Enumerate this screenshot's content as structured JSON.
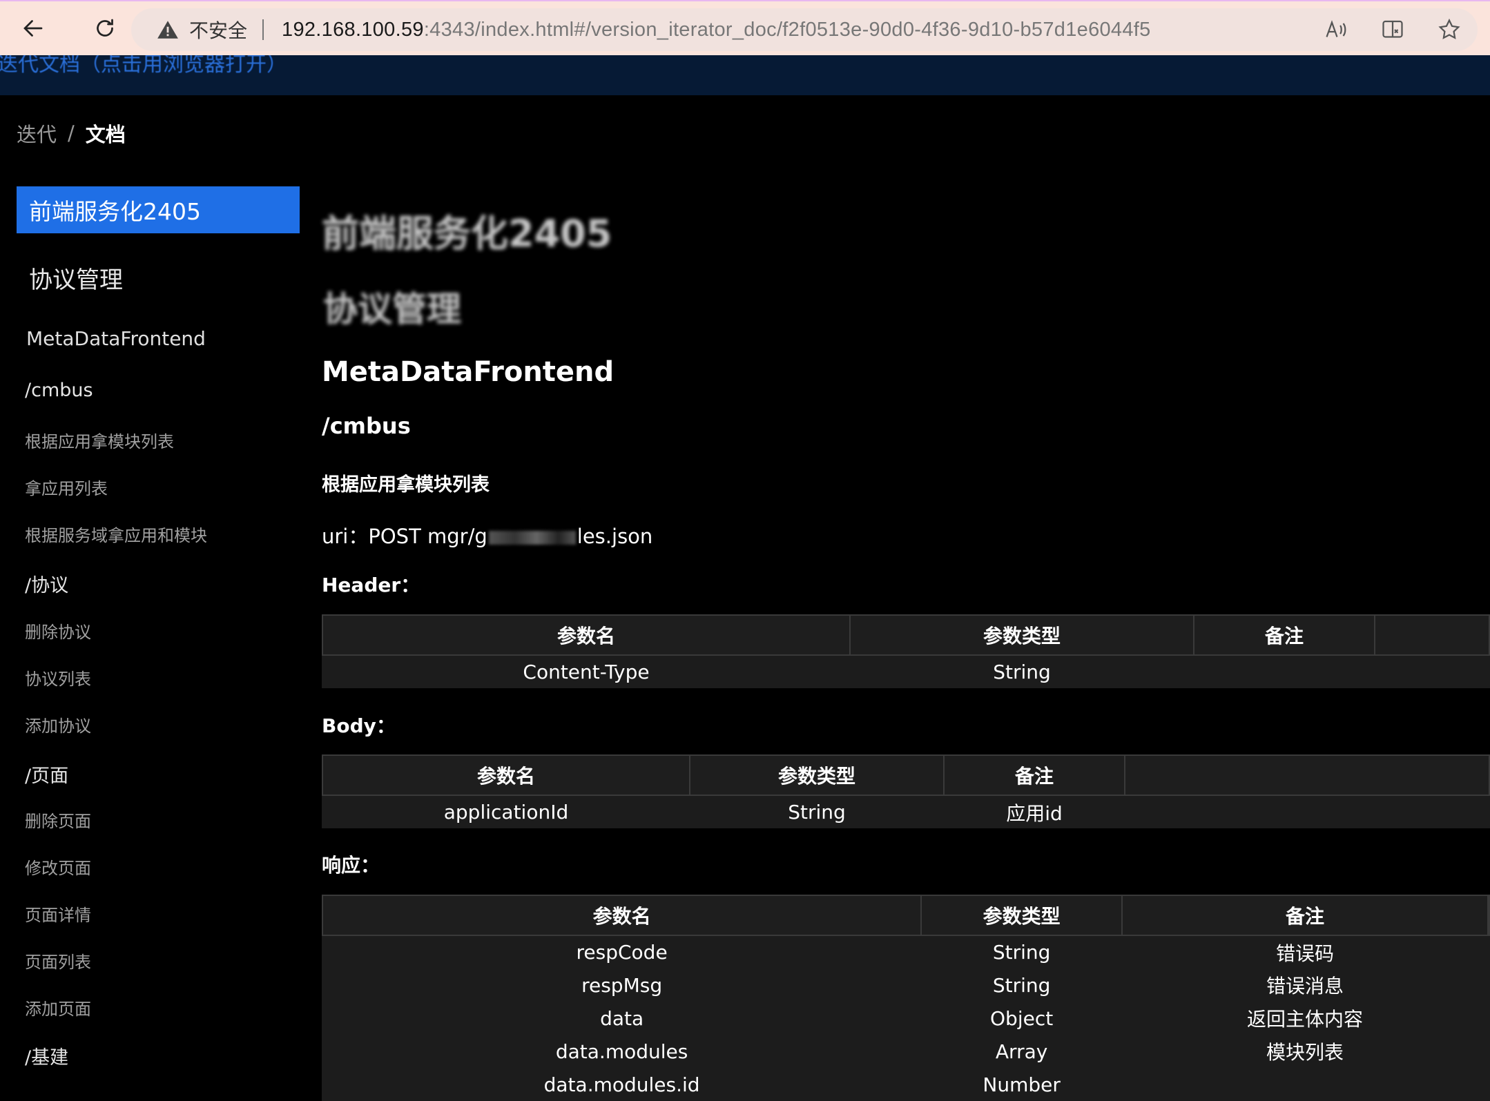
{
  "browser": {
    "insecure_label": "不安全",
    "url_host": "192.168.100.59",
    "url_rest": ":4343/index.html#/version_iterator_doc/f2f0513e-90d0-4f36-9d10-b57d1e6044f5"
  },
  "banner": {
    "link_text": "迭代文档（点击用浏览器打开）"
  },
  "breadcrumb": {
    "parent": "迭代",
    "separator": "/",
    "current": "文档"
  },
  "sidebar": {
    "active": "前端服务化2405",
    "h2": "协议管理",
    "h3": "MetaDataFrontend",
    "items": [
      {
        "label": "/cmbus",
        "level": "h4"
      },
      {
        "label": "根据应用拿模块列表",
        "level": "h5"
      },
      {
        "label": "拿应用列表",
        "level": "h5"
      },
      {
        "label": "根据服务域拿应用和模块",
        "level": "h5"
      },
      {
        "label": "/协议",
        "level": "h4"
      },
      {
        "label": "删除协议",
        "level": "h5"
      },
      {
        "label": "协议列表",
        "level": "h5"
      },
      {
        "label": "添加协议",
        "level": "h5"
      },
      {
        "label": "/页面",
        "level": "h4"
      },
      {
        "label": "删除页面",
        "level": "h5"
      },
      {
        "label": "修改页面",
        "level": "h5"
      },
      {
        "label": "页面详情",
        "level": "h5"
      },
      {
        "label": "页面列表",
        "level": "h5"
      },
      {
        "label": "添加页面",
        "level": "h5"
      },
      {
        "label": "/基建",
        "level": "h4"
      }
    ]
  },
  "doc": {
    "h1": "前端服务化2405",
    "h2": "协议管理",
    "h3": "MetaDataFrontend",
    "h4": "/cmbus",
    "h5": "根据应用拿模块列表",
    "uri_prefix": "uri：POST mgr/g",
    "uri_suffix": "les.json",
    "header_label": "Header：",
    "body_label": "Body：",
    "response_label": "响应：",
    "header_table": {
      "columns": [
        "参数名",
        "参数类型",
        "备注"
      ],
      "rows": [
        [
          "Content-Type",
          "String",
          ""
        ]
      ]
    },
    "body_table": {
      "columns": [
        "参数名",
        "参数类型",
        "备注"
      ],
      "rows": [
        [
          "applicationId",
          "String",
          "应用id"
        ]
      ]
    },
    "response_table": {
      "columns": [
        "参数名",
        "参数类型",
        "备注"
      ],
      "rows": [
        [
          "respCode",
          "String",
          "错误码"
        ],
        [
          "respMsg",
          "String",
          "错误消息"
        ],
        [
          "data",
          "Object",
          "返回主体内容"
        ],
        [
          "data.modules",
          "Array",
          "模块列表"
        ],
        [
          "data.modules.id",
          "Number",
          ""
        ]
      ]
    }
  }
}
